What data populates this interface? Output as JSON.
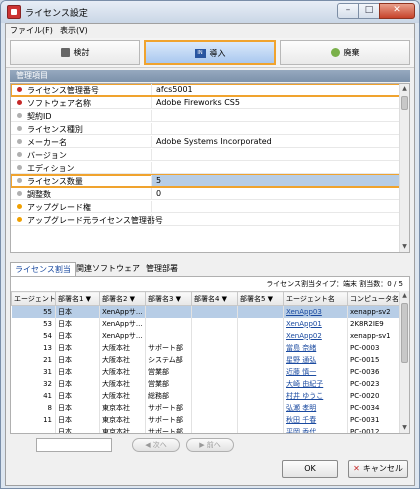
{
  "window": {
    "title": "ライセンス設定",
    "min": "–",
    "max": "□",
    "close": "✕"
  },
  "menu": [
    "ファイル(F)",
    "表示(V)"
  ],
  "toolbar": {
    "search": "検討",
    "install": "導入",
    "discard": "廃棄",
    "install_icon_text": "IN"
  },
  "section_title": "管理項目",
  "properties": [
    {
      "label": "ライセンス管理番号",
      "value": "afcs5001",
      "dot": "red"
    },
    {
      "label": "ソフトウェア名称",
      "value": "Adobe Fireworks CS5",
      "dot": "red"
    },
    {
      "label": "契約ID",
      "value": "",
      "dot": "gray"
    },
    {
      "label": "ライセンス種別",
      "value": "",
      "dot": "gray"
    },
    {
      "label": "メーカー名",
      "value": "Adobe Systems Incorporated",
      "dot": "gray"
    },
    {
      "label": "バージョン",
      "value": "",
      "dot": "gray"
    },
    {
      "label": "エディション",
      "value": "",
      "dot": "gray"
    },
    {
      "label": "ライセンス数量",
      "value": "5",
      "dot": "gray"
    },
    {
      "label": "調整数",
      "value": "0",
      "dot": "gray"
    },
    {
      "label": "アップグレード権",
      "value": "",
      "dot": "orange"
    },
    {
      "label": "アップグレード元ライセンス管理番号",
      "value": "",
      "dot": "orange"
    }
  ],
  "tabs": [
    "ライセンス割当",
    "関連ソフトウェア",
    "管理部署"
  ],
  "grid": {
    "info": "ライセンス割当タイプ：端末 割当数：0 / 5",
    "columns": [
      "エージェントNO",
      "部署名1 ▼",
      "部署名2 ▼",
      "部署名3 ▼",
      "部署名4 ▼",
      "部署名5 ▼",
      "エージェント名",
      "コンピュータ名"
    ],
    "rows": [
      [
        "55",
        "日本",
        "XenAppサ...",
        "",
        "",
        "",
        "XenApp03",
        "xenapp-sv2"
      ],
      [
        "53",
        "日本",
        "XenAppサ...",
        "",
        "",
        "",
        "XenApp01",
        "2K8R2IE9"
      ],
      [
        "54",
        "日本",
        "XenAppサ...",
        "",
        "",
        "",
        "XenApp02",
        "xenapp-sv1"
      ],
      [
        "13",
        "日本",
        "大阪本社",
        "サポート部",
        "",
        "",
        "當島 奈緒",
        "PC-0003"
      ],
      [
        "21",
        "日本",
        "大阪本社",
        "システム部",
        "",
        "",
        "星野 通弘",
        "PC-0015"
      ],
      [
        "31",
        "日本",
        "大阪本社",
        "営業部",
        "",
        "",
        "近藤 慎一",
        "PC-0036"
      ],
      [
        "32",
        "日本",
        "大阪本社",
        "営業部",
        "",
        "",
        "大崎 由紀子",
        "PC-0023"
      ],
      [
        "41",
        "日本",
        "大阪本社",
        "総務部",
        "",
        "",
        "村井 ゆうこ",
        "PC-0020"
      ],
      [
        "8",
        "日本",
        "東京本社",
        "サポート部",
        "",
        "",
        "弘瀬 孝明",
        "PC-0034"
      ],
      [
        "11",
        "日本",
        "東京本社",
        "サポート部",
        "",
        "",
        "秋田 千春",
        "PC-0031"
      ],
      [
        "",
        "日本",
        "東京本社",
        "サポート部",
        "",
        "",
        "平岡 香代",
        "PC-0012"
      ]
    ]
  },
  "pager": {
    "next": "次へ",
    "prev": "前へ"
  },
  "footer": {
    "ok": "OK",
    "cancel": "キャンセル"
  },
  "colors": {
    "highlight": "#f0a32e",
    "selection": "#b7cde6",
    "link": "#1a4aa0"
  }
}
